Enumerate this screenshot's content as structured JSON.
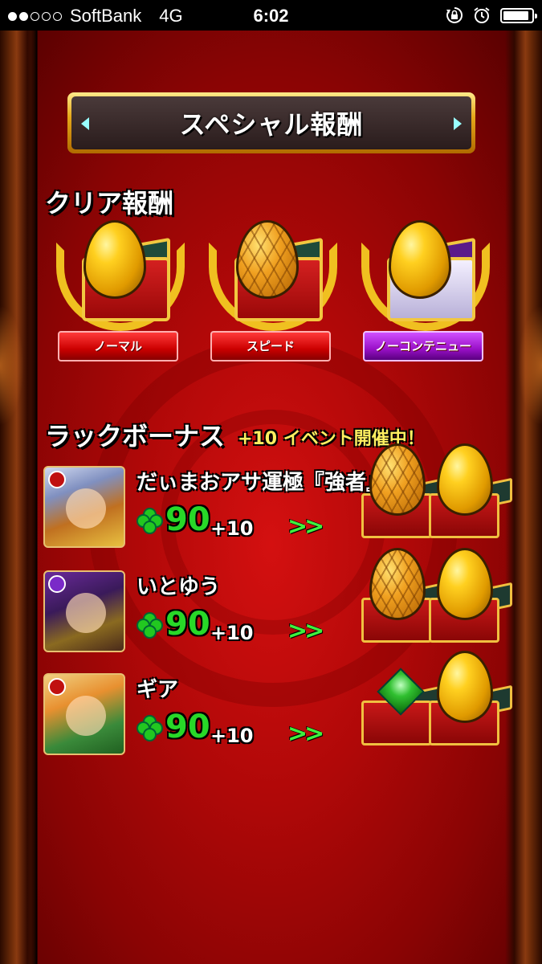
{
  "status_bar": {
    "signal_dots_filled": 2,
    "signal_dots_total": 5,
    "carrier": "SoftBank",
    "network": "4G",
    "time": "6:02",
    "icons": [
      "rotation-lock-icon",
      "alarm-icon",
      "battery-icon"
    ],
    "battery_level": 0.9
  },
  "title": "スペシャル報酬",
  "clear_rewards": {
    "heading": "クリア報酬",
    "items": [
      {
        "label": "ノーマル",
        "egg": "gold-egg",
        "ribbon_color": "#c00000"
      },
      {
        "label": "スピード",
        "egg": "hex-egg",
        "ribbon_color": "#c00000"
      },
      {
        "label": "ノーコンテニュー",
        "egg": "gold-egg",
        "ribbon_color": "#9a10c8"
      }
    ]
  },
  "luck_bonus": {
    "heading": "ラックボーナス",
    "event_text": "+10 イベント開催中！",
    "rows": [
      {
        "name": "だぃまおアサ運極『強者』",
        "luck": "90",
        "bonus": "+10",
        "arrow": ">>",
        "rewards": [
          "hex-egg",
          "gold-egg"
        ]
      },
      {
        "name": "いとゆう",
        "luck": "90",
        "bonus": "+10",
        "arrow": ">>",
        "rewards": [
          "hex-egg",
          "gold-egg"
        ]
      },
      {
        "name": "ギア",
        "luck": "90",
        "bonus": "+10",
        "arrow": ">>",
        "rewards": [
          "green-gem",
          "gold-egg"
        ]
      }
    ]
  },
  "colors": {
    "background_red": "#b00808",
    "gold": "#f0c020",
    "luck_green": "#28d828",
    "event_yellow": "#ffef60"
  }
}
